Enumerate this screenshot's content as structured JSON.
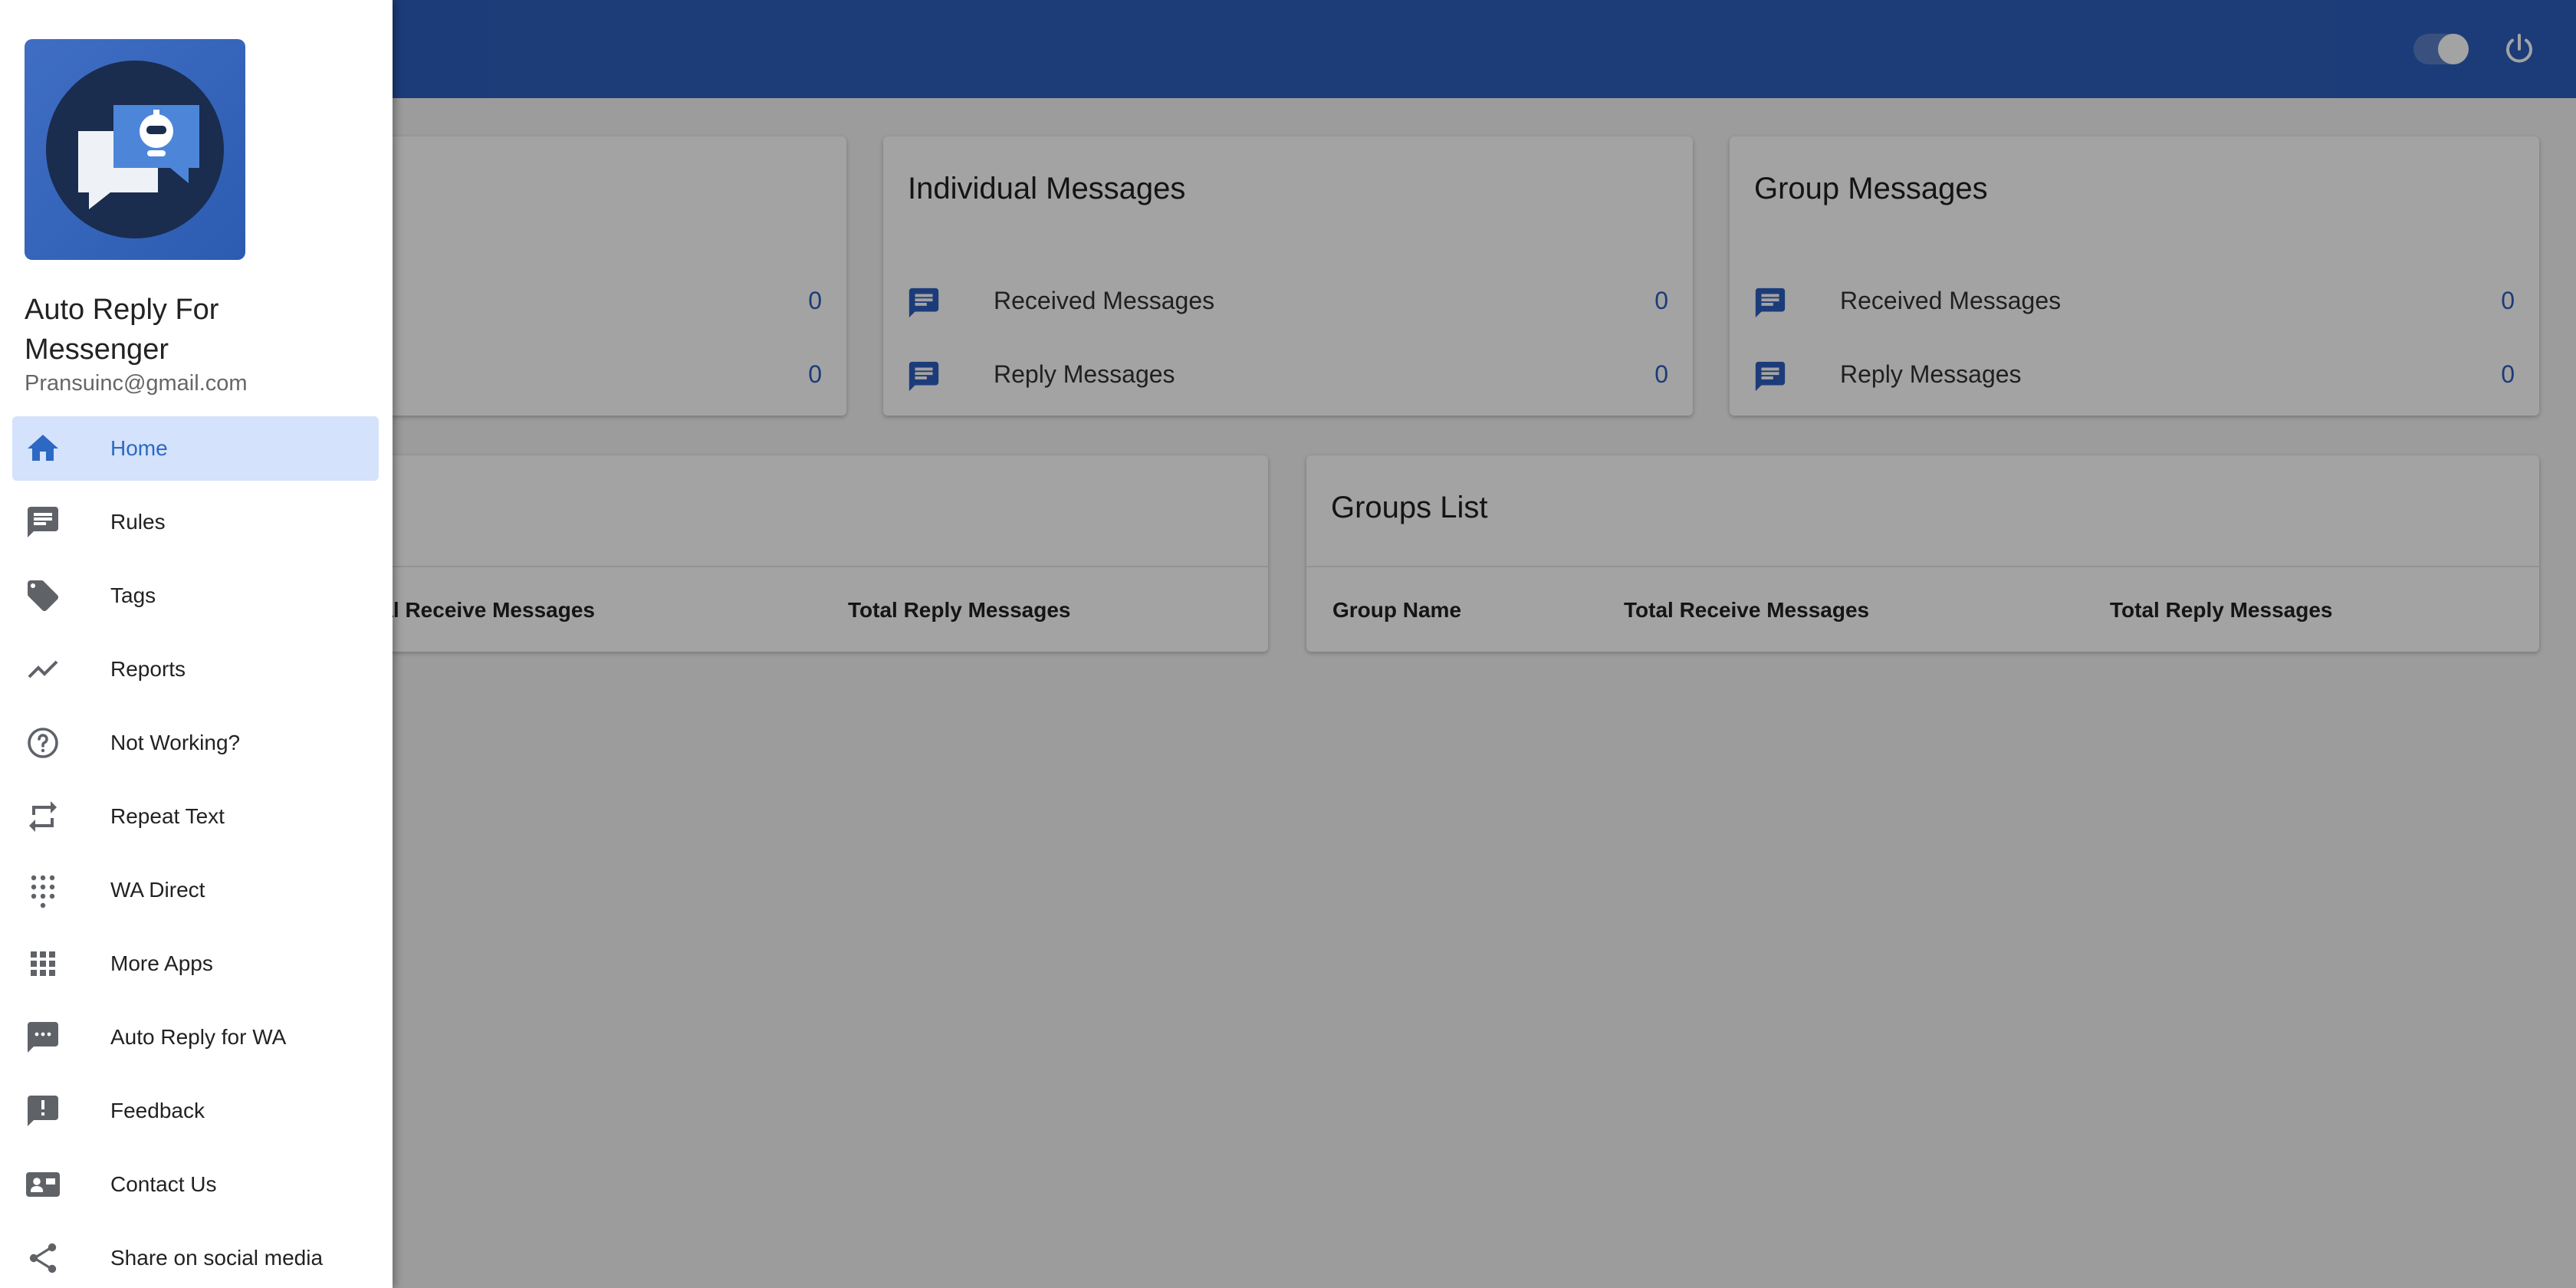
{
  "colors": {
    "accent": "#2d5fbd",
    "nav_active_bg": "#d4e2fb",
    "icon_grey": "#5f6368",
    "logo_circle": "#1a2d4f"
  },
  "topbar": {
    "toggle_icon": "toggle-icon",
    "power_icon": "power-icon"
  },
  "stats": {
    "total": {
      "received_value": "0",
      "reply_value": "0"
    },
    "individual": {
      "title": "Individual Messages",
      "received_label": "Received Messages",
      "received_value": "0",
      "reply_label": "Reply Messages",
      "reply_value": "0"
    },
    "group": {
      "title": "Group Messages",
      "received_label": "Received Messages",
      "received_value": "0",
      "reply_label": "Reply Messages",
      "reply_value": "0"
    }
  },
  "contacts_table": {
    "col_receive_partial": "tal Receive Messages",
    "col_reply": "Total Reply Messages"
  },
  "groups_table": {
    "title": "Groups List",
    "col_name": "Group Name",
    "col_receive": "Total Receive Messages",
    "col_reply": "Total Reply Messages"
  },
  "drawer": {
    "app_name": "Auto Reply For Messenger",
    "email": "Pransuinc@gmail.com",
    "items": [
      {
        "label": "Home",
        "icon": "home-icon",
        "active": true
      },
      {
        "label": "Rules",
        "icon": "message-icon"
      },
      {
        "label": "Tags",
        "icon": "tag-icon"
      },
      {
        "label": "Reports",
        "icon": "trending-icon"
      },
      {
        "label": "Not Working?",
        "icon": "help-icon"
      },
      {
        "label": "Repeat Text",
        "icon": "repeat-icon"
      },
      {
        "label": "WA Direct",
        "icon": "dialpad-icon"
      },
      {
        "label": "More Apps",
        "icon": "apps-icon"
      },
      {
        "label": "Auto Reply for WA",
        "icon": "sms-icon"
      },
      {
        "label": "Feedback",
        "icon": "feedback-icon"
      },
      {
        "label": "Contact Us",
        "icon": "contact-card-icon"
      },
      {
        "label": "Share on social media",
        "icon": "share-icon"
      }
    ]
  }
}
